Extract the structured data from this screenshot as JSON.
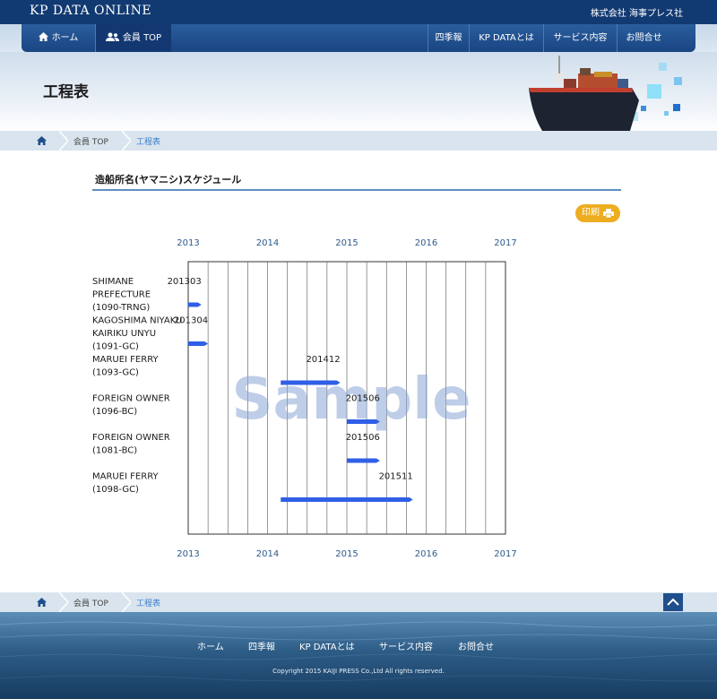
{
  "site": {
    "logo": "KP DATA ONLINE",
    "company": "株式会社 海事プレス社"
  },
  "nav": {
    "home": "ホーム",
    "member_top": "会員 TOP",
    "right": [
      "四季報",
      "KP DATAとは",
      "サービス内容",
      "お問合せ"
    ]
  },
  "page": {
    "title": "工程表"
  },
  "breadcrumb": {
    "member_top": "会員 TOP",
    "current": "工程表"
  },
  "section": {
    "title": "造船所名(ヤマニシ)スケジュール",
    "print_label": "印刷"
  },
  "colors": {
    "bar": "#2f5fe6",
    "watermark": "#8aa6d6",
    "axis_label": "#2e5a8a",
    "print": "#ecad1f"
  },
  "chart_data": {
    "type": "gantt",
    "x_ticks": [
      2013,
      2014,
      2015,
      2016,
      2017
    ],
    "xlim": [
      "2013-01",
      "2017-01"
    ],
    "grid": true,
    "watermark": "Sample",
    "rows": [
      {
        "label": [
          "SHIMANE",
          "PREFECTURE",
          "(1090-TRNG)"
        ],
        "start": "2013-01",
        "end": "2013-03",
        "end_label": "201303"
      },
      {
        "label": [
          "KAGOSHIMA NIYAKU",
          "KAIRIKU UNYU",
          "(1091-GC)"
        ],
        "start": "2013-01",
        "end": "2013-04",
        "end_label": "201304"
      },
      {
        "label": [
          "MARUEI FERRY",
          "(1093-GC)"
        ],
        "start": "2014-03",
        "end": "2014-12",
        "end_label": "201412"
      },
      {
        "label": [
          "FOREIGN OWNER",
          "(1096-BC)"
        ],
        "start": "2015-01",
        "end": "2015-06",
        "end_label": "201506"
      },
      {
        "label": [
          "FOREIGN OWNER",
          "(1081-BC)"
        ],
        "start": "2015-01",
        "end": "2015-06",
        "end_label": "201506"
      },
      {
        "label": [
          "MARUEI FERRY",
          "(1098-GC)"
        ],
        "start": "2014-03",
        "end": "2015-11",
        "end_label": "201511"
      }
    ]
  },
  "footer": {
    "links": [
      "ホーム",
      "四季報",
      "KP DATAとは",
      "サービス内容",
      "お問合せ"
    ],
    "copyright": "Copyright 2015 KAIJI PRESS Co.,Ltd All rights reserved."
  }
}
